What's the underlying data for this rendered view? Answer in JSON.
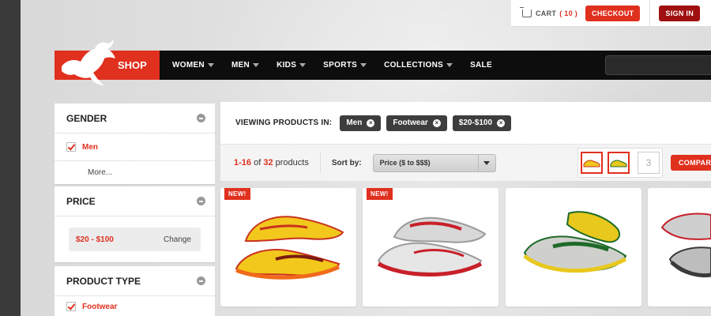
{
  "topbar": {
    "cart_label": "CART",
    "cart_count": "( 10 )",
    "checkout_label": "CHECKOUT",
    "signin_label": "SIGN IN"
  },
  "nav": {
    "shop_label": "SHOP",
    "items": [
      {
        "label": "WOMEN",
        "dropdown": true
      },
      {
        "label": "MEN",
        "dropdown": true
      },
      {
        "label": "KIDS",
        "dropdown": true
      },
      {
        "label": "SPORTS",
        "dropdown": true
      },
      {
        "label": "COLLECTIONS",
        "dropdown": true
      },
      {
        "label": "SALE",
        "dropdown": false
      }
    ]
  },
  "sidebar": {
    "gender": {
      "title": "GENDER",
      "selected": "Men",
      "more": "More..."
    },
    "price": {
      "title": "PRICE",
      "value": "$20 - $100",
      "change": "Change"
    },
    "product_type": {
      "title": "PRODUCT TYPE",
      "selected": "Footwear"
    }
  },
  "main": {
    "viewing_label": "VIEWING PRODUCTS IN:",
    "filters": [
      "Men",
      "Footwear",
      "$20-$100"
    ],
    "count_range": "1-16",
    "count_of": "of",
    "count_total": "32",
    "count_suffix": "products",
    "sort_label": "Sort by:",
    "sort_value": "Price ($ to $$$)",
    "compare_empty_slot": "3",
    "compare_label": "COMPARE"
  },
  "products": [
    {
      "badge": "NEW!",
      "colors": {
        "main": "#f2c81c",
        "accent": "#c8321e",
        "sole": "#f06a1a"
      }
    },
    {
      "badge": "NEW!",
      "colors": {
        "main": "#d8d8d8",
        "accent": "#c8202a",
        "sole": "#9a9a9a"
      }
    },
    {
      "badge": "",
      "colors": {
        "main": "#cfd0cc",
        "accent": "#1f6a2a",
        "sole": "#e8c81c"
      }
    },
    {
      "badge": "",
      "colors": {
        "main": "#cfcfcf",
        "accent": "#c8202a",
        "sole": "#3a3a3a"
      }
    }
  ],
  "colors": {
    "accent": "#e0301e",
    "nav": "#0d0d0d",
    "signin": "#a01010"
  }
}
